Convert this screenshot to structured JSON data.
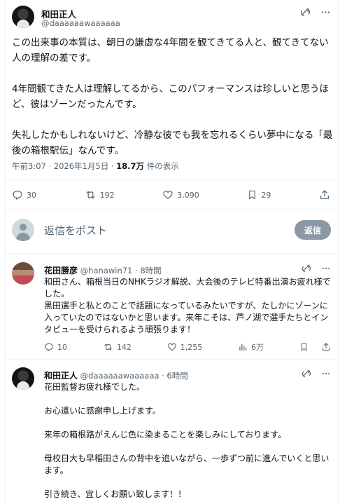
{
  "main_tweet": {
    "author_name": "和田正人",
    "author_handle": "@daaaaaawaaaaaa",
    "paragraphs": [
      "この出来事の本質は、朝日の謙虚な4年間を観てきてる人と、観てきてない人の理解の差です。",
      "4年間観てきた人は理解してるから、このパフォーマンスは珍しいと思うほど、彼はゾーンだったんです。",
      "失礼したかもしれないけど、冷静な彼でも我を忘れるくらい夢中になる「最後の箱根駅伝」なんです。"
    ],
    "time": "午前3:07 · 2026年1月5日",
    "views_count": "18.7万",
    "views_label": " 件の表示",
    "stats": {
      "replies": "30",
      "retweets": "192",
      "likes": "3,090",
      "bookmarks": "29"
    }
  },
  "reply_box": {
    "placeholder": "返信をポスト",
    "button_label": "返信"
  },
  "replies": [
    {
      "author_name": "花田勝彦",
      "author_handle": "@hanawin71",
      "time": "8時間",
      "lines": [
        "和田さん、箱根当日のNHKラジオ解説、大会後のテレビ特番出演お疲れ様でした。",
        "黒田選手と私とのことで話題になっているみたいですが、たしかにゾーンに入っていたのではないかと思います。来年こそは、芦ノ湖で選手たちとインタビューを受けられるよう頑張ります！"
      ],
      "stats": {
        "replies": "10",
        "retweets": "142",
        "likes": "1,255",
        "views": "6万"
      }
    },
    {
      "author_name": "和田正人",
      "author_handle": "@daaaaaawaaaaaa",
      "time": "6時間",
      "lines": [
        "花田監督お疲れ様でした。",
        "お心遣いに感謝申し上げます。",
        "来年の箱根路がえんじ色に染まることを楽しみにしております。",
        "母校日大も早稲田さんの背中を追いながら、一歩ずつ前に進んでいくと思います。",
        "引き続き、宜しくお願い致します！！"
      ]
    }
  ],
  "colors": {
    "text": "#0f1419",
    "secondary": "#536471",
    "border": "#eff3f4",
    "reply_button": "#8b98a5"
  }
}
